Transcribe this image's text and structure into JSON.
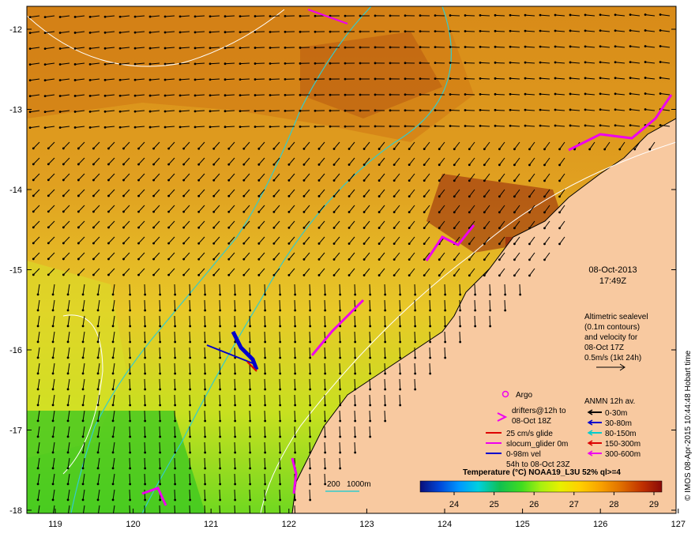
{
  "map": {
    "timestamp_date": "08-Oct-2013",
    "timestamp_time": "17:49Z",
    "credit": "© IMOS 08-Apr-2015 10:44:48 Hobart time",
    "x_ticks": [
      "119",
      "120",
      "121",
      "122",
      "123",
      "124",
      "125",
      "126",
      "127"
    ],
    "y_ticks": [
      "-12",
      "-13",
      "-14",
      "-15",
      "-16",
      "-17",
      "-18"
    ]
  },
  "altimetry_note": [
    "Altimetric sealevel",
    "(0.1m contours)",
    "and velocity for",
    "08-Oct 17Z",
    "0.5m/s (1kt 24h)"
  ],
  "legend_left": {
    "argo": "Argo",
    "drifters": [
      "drifters@12h to",
      "08-Oct 18Z"
    ],
    "glide": "25 cm/s glide",
    "slocum": "slocum_glider 0m",
    "vel": [
      "0-98m vel",
      "54h to 08-Oct 23Z"
    ]
  },
  "legend_anmn": {
    "title": "ANMN 12h av.",
    "items": [
      {
        "label": "0-30m",
        "color": "#000000"
      },
      {
        "label": "30-80m",
        "color": "#0000cc"
      },
      {
        "label": "80-150m",
        "color": "#00cccc"
      },
      {
        "label": "150-300m",
        "color": "#dd0000"
      },
      {
        "label": "300-600m",
        "color": "#ee00ee"
      }
    ]
  },
  "contour_scale": {
    "a": "200",
    "b": "1000m"
  },
  "colorbar": {
    "title": "Temperature (°C) NOAA19_L3U 52% ql>=4",
    "ticks": [
      "24",
      "25",
      "26",
      "27",
      "28",
      "29"
    ],
    "colors": [
      "#0a0f7a",
      "#0046d8",
      "#0096ff",
      "#00d0e0",
      "#10c050",
      "#40dc20",
      "#a8f010",
      "#e8f000",
      "#ffd000",
      "#f8a000",
      "#e07000",
      "#c03000",
      "#8a0a08"
    ]
  },
  "colors": {
    "land": "#f8c9a0",
    "sea": "#e0a020",
    "vector": "#000000",
    "bathy": "#33cccc"
  }
}
